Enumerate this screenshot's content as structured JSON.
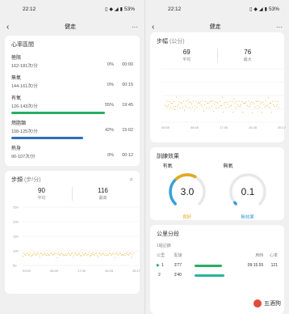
{
  "left": {
    "status": {
      "time": "22:12",
      "battery": "53%"
    },
    "nav": {
      "title": "健走"
    },
    "heart": {
      "title": "心率區間",
      "zones": [
        {
          "name": "極限",
          "range": "162-181次/分",
          "pct": "0%",
          "time": "00:00",
          "fill": 0,
          "color": "#cccccc"
        },
        {
          "name": "無氧",
          "range": "144-161次/分",
          "pct": "0%",
          "time": "00:15",
          "fill": 0,
          "color": "#cccccc"
        },
        {
          "name": "有氧",
          "range": "126-143次/分",
          "pct": "55%",
          "time": "19:45",
          "fill": 0.55,
          "color": "#27ae60"
        },
        {
          "name": "燃脂類",
          "range": "108-125次/分",
          "pct": "42%",
          "time": "15:02",
          "fill": 0.42,
          "color": "#2d6fb5"
        },
        {
          "name": "熱身",
          "range": "90-107次/分",
          "pct": "0%",
          "time": "00:12",
          "fill": 0,
          "color": "#cccccc"
        }
      ]
    },
    "cadence": {
      "title": "步頻",
      "unit": "(步/分)",
      "avg_value": "90",
      "avg_label": "平均",
      "max_value": "116",
      "max_label": "最高",
      "yticks": [
        "250",
        "200",
        "150",
        "100",
        "50"
      ],
      "xticks": [
        "00:00",
        "08:49",
        "17:39",
        "26:28",
        "35:17"
      ]
    }
  },
  "right": {
    "status": {
      "time": "22:12",
      "battery": "53%"
    },
    "nav": {
      "title": "健走"
    },
    "stride": {
      "title": "步幅",
      "unit": "(公分)",
      "avg_value": "69",
      "avg_label": "平均",
      "max_value": "76",
      "max_label": "最大",
      "xticks": [
        "00:00",
        "08:49",
        "17:39",
        "26:28",
        "35:17"
      ]
    },
    "training": {
      "title": "訓練效果",
      "aerobic_label": "有氧",
      "aerobic_value": "3.0",
      "aerobic_sub": "良好",
      "aerobic_level": 0.6,
      "anaerobic_label": "無氧",
      "anaerobic_value": "0.1",
      "anaerobic_sub": "無效果",
      "anaerobic_level": 0.02,
      "accent_good": "#e6a817",
      "accent_none": "#3aa0d8"
    },
    "splits": {
      "title": "公里分段",
      "meta": "1組記錄",
      "headers": [
        "公里",
        "配速",
        "用時",
        "心率"
      ],
      "rows": [
        {
          "km": "1",
          "pace": "3'77",
          "fill": 0.55,
          "color": "#27ae60",
          "time": "09:15.55",
          "hr": "121"
        },
        {
          "km": "2",
          "pace": "3'40",
          "fill": 0.6,
          "color": "#2bb3a0",
          "time": "",
          "hr": ""
        }
      ]
    },
    "watermark": "五酒狗"
  }
}
